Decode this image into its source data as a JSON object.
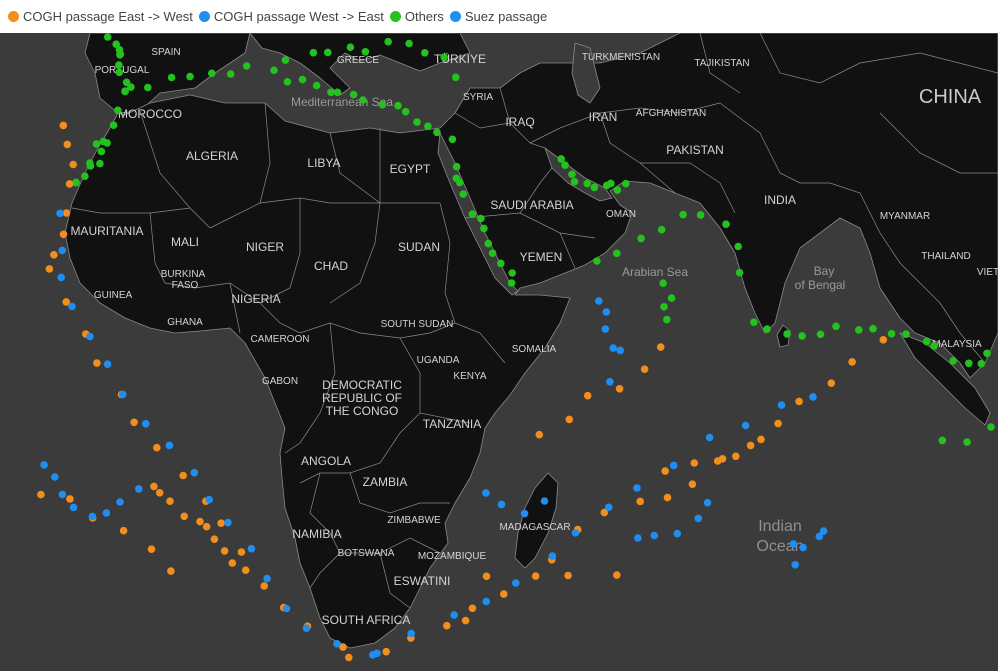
{
  "legend": [
    {
      "label": "COGH passage East -> West",
      "color": "#f28e1c"
    },
    {
      "label": "COGH passage West -> East",
      "color": "#1f8ef1"
    },
    {
      "label": "Others",
      "color": "#23c21f"
    },
    {
      "label": "Suez passage",
      "color": "#1f8ef1"
    }
  ],
  "map": {
    "water_color": "#3b3b3b",
    "land_color": "#111111",
    "border_color": "#8a8a8a"
  },
  "labels": {
    "spain": "SPAIN",
    "portugal": "PORTUGAL",
    "morocco": "MOROCCO",
    "algeria": "ALGERIA",
    "libya": "LIBYA",
    "egypt": "EGYPT",
    "greece": "GREECE",
    "turkiye": "TÜRKIYE",
    "syria": "SYRIA",
    "iraq": "IRAQ",
    "iran": "IRAN",
    "turkmenistan": "TURKMENISTAN",
    "tajikistan": "TAJIKISTAN",
    "afghanistan": "AFGHANISTAN",
    "pakistan": "PAKISTAN",
    "china": "CHINA",
    "india": "INDIA",
    "myanmar": "MYANMAR",
    "thailand": "THAILAND",
    "viet": "VIET",
    "malaysia": "MALAYSIA",
    "saudi_arabia": "SAUDI ARABIA",
    "oman": "OMAN",
    "yemen": "YEMEN",
    "sudan": "SUDAN",
    "mauritania": "MAURITANIA",
    "mali": "MALI",
    "niger": "NIGER",
    "chad": "CHAD",
    "burkina_1": "BURKINA",
    "burkina_2": "FASO",
    "guinea": "GUINEA",
    "nigeria": "NIGERIA",
    "ghana": "GHANA",
    "cameroon": "CAMEROON",
    "gabon": "GABON",
    "south_sudan": "SOUTH SUDAN",
    "somalia": "SOMALIA",
    "uganda": "UGANDA",
    "kenya": "KENYA",
    "drc_1": "DEMOCRATIC",
    "drc_2": "REPUBLIC OF",
    "drc_3": "THE CONGO",
    "tanzania": "TANZANIA",
    "angola": "ANGOLA",
    "zambia": "ZAMBIA",
    "zimbabwe": "ZIMBABWE",
    "namibia": "NAMIBIA",
    "botswana": "BOTSWANA",
    "mozambique": "MOZAMBIQUE",
    "madagascar": "MADAGASCAR",
    "eswatini": "ESWATINI",
    "south_africa": "SOUTH AFRICA",
    "mediterranean": "Mediterranean Sea",
    "arabian_sea": "Arabian Sea",
    "bay_of_bengal_1": "Bay",
    "bay_of_bengal_2": "of Bengal",
    "indian_ocean_1": "Indian",
    "indian_ocean_2": "Ocean"
  }
}
